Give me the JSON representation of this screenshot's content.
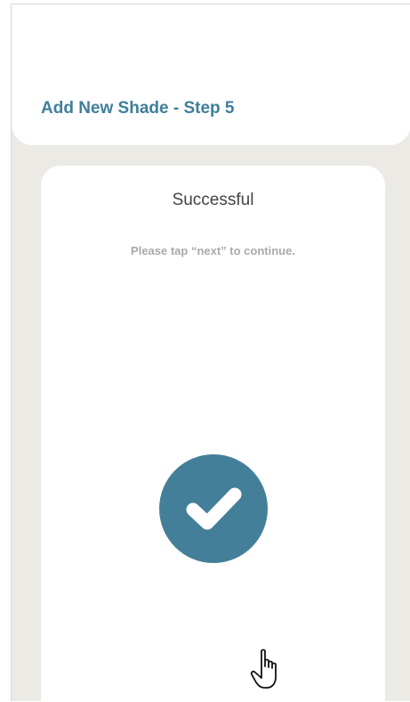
{
  "header": {
    "title": "Add New Shade - Step 5"
  },
  "card": {
    "title": "Successful",
    "instruction": "Please tap “next” to continue."
  },
  "status": {
    "icon": "checkmark-icon"
  },
  "colors": {
    "accent": "#447f99",
    "header_text": "#3f7f99",
    "background": "#ebeae5",
    "card": "#ffffff",
    "muted_text": "#a9a9a9"
  }
}
